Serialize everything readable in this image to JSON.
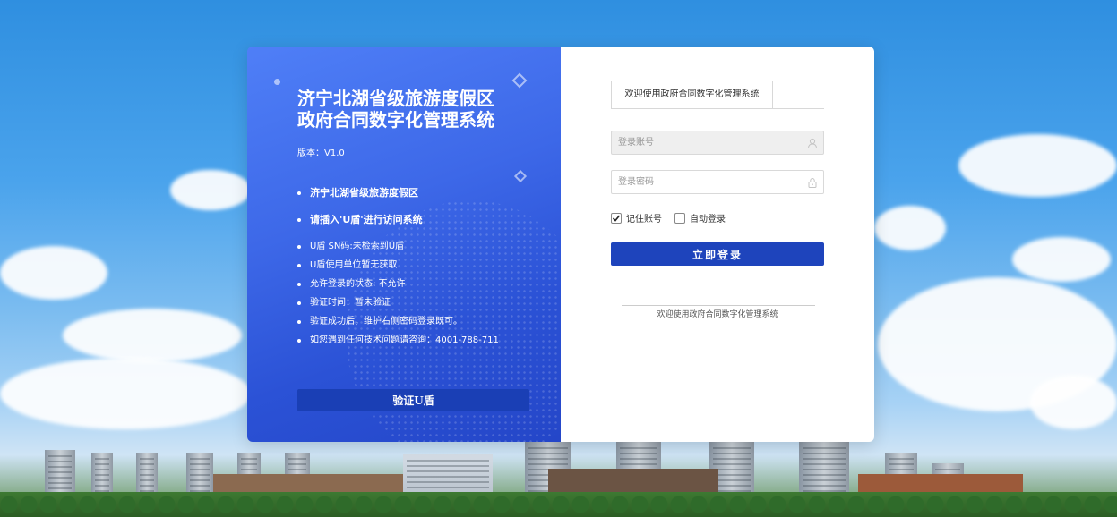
{
  "left_panel": {
    "title_line1": "济宁北湖省级旅游度假区",
    "title_line2": "政府合同数字化管理系统",
    "version": "版本：V1.0",
    "info_strong": [
      "济宁北湖省级旅游度假区",
      "请插入'U盾'进行访问系统"
    ],
    "info_plain": [
      "U盾 SN码:未检索到U盾",
      "U盾使用单位暂无获取",
      "允许登录的状态: 不允许",
      "验证时间：暂未验证",
      "验证成功后，维护右侧密码登录既可。",
      "如您遇到任何技术问题请咨询：4001-788-711"
    ],
    "verify_button": "验证U盾"
  },
  "login": {
    "tab_label": "欢迎使用政府合同数字化管理系统",
    "account_placeholder": "登录账号",
    "password_placeholder": "登录密码",
    "remember_label": "记住账号",
    "remember_checked": true,
    "auto_login_label": "自动登录",
    "auto_login_checked": false,
    "submit_button": "立即登录",
    "footer_text": "欢迎使用政府合同数字化管理系统",
    "account_icon": "user-icon",
    "password_icon": "lock-icon"
  },
  "colors": {
    "panel_gradient_top": "#4f7ff7",
    "panel_gradient_bottom": "#2446c8",
    "primary_button": "#1e44bc",
    "verify_button": "#1a3fb5"
  }
}
